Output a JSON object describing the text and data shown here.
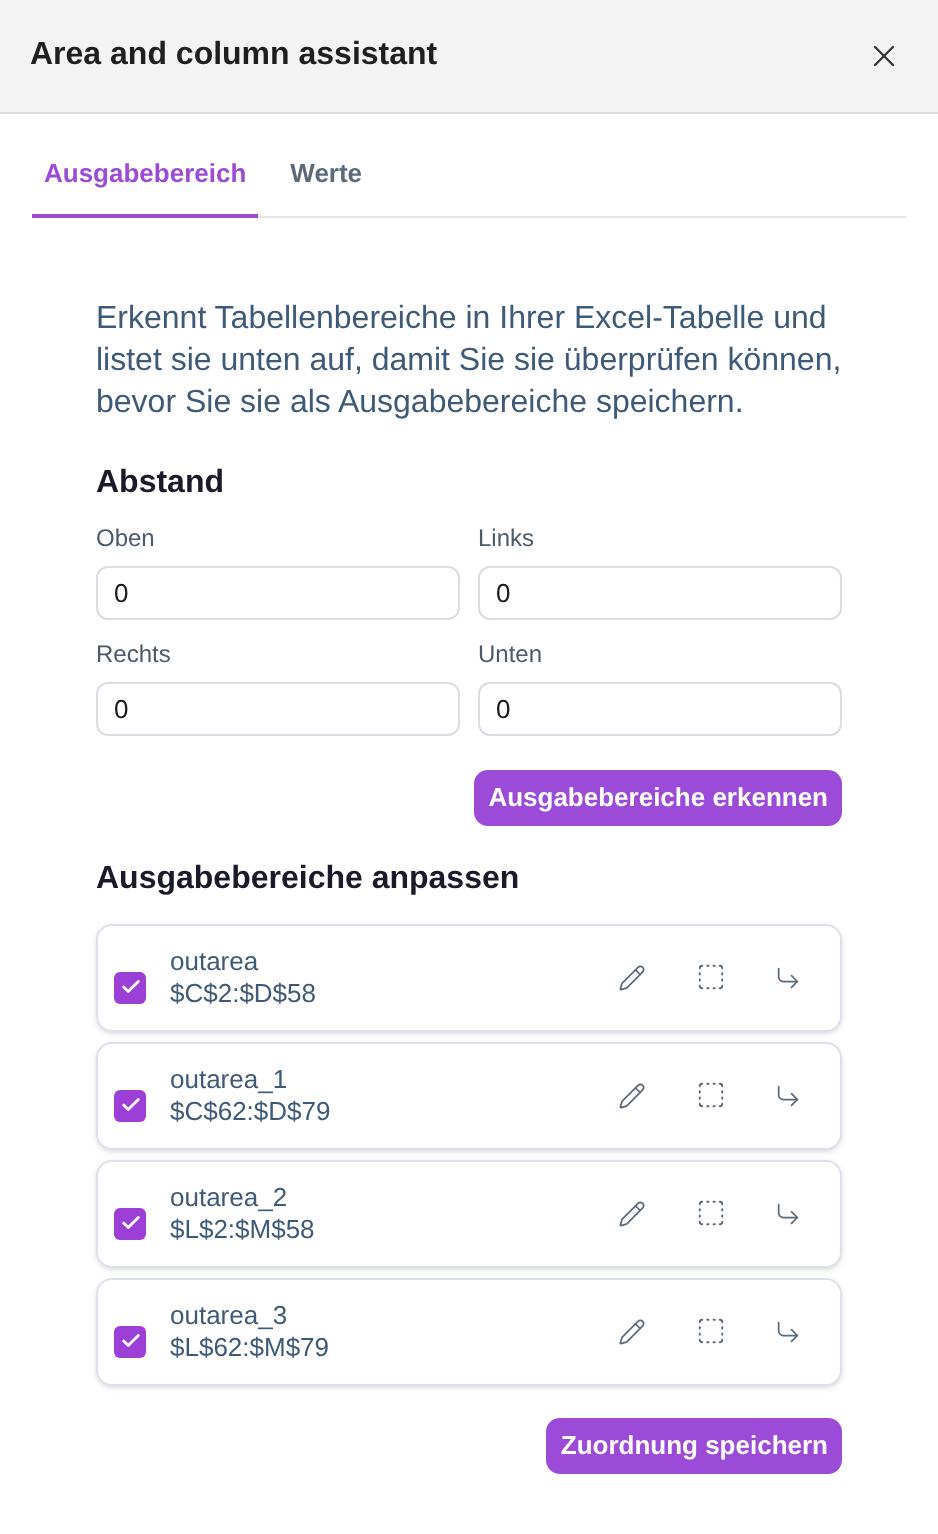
{
  "window": {
    "title": "Area and column assistant"
  },
  "tabs": [
    {
      "label": "Ausgabebereich",
      "selected": true
    },
    {
      "label": "Werte",
      "selected": false
    }
  ],
  "description": "Erkennt Tabellenbereiche in Ihrer Excel-Tabelle und listet sie unten auf, damit Sie sie überprüfen können, bevor Sie sie als Ausgabebereiche speichern.",
  "spacing": {
    "heading": "Abstand",
    "fields": [
      {
        "label": "Oben",
        "value": "0"
      },
      {
        "label": "Links",
        "value": "0"
      },
      {
        "label": "Rechts",
        "value": "0"
      },
      {
        "label": "Unten",
        "value": "0"
      }
    ]
  },
  "detect_button": "Ausgabebereiche erkennen",
  "areas": {
    "heading": "Ausgabebereiche anpassen",
    "items": [
      {
        "name": "outarea",
        "range": "$C$2:$D$58",
        "checked": true
      },
      {
        "name": "outarea_1",
        "range": "$C$62:$D$79",
        "checked": true
      },
      {
        "name": "outarea_2",
        "range": "$L$2:$M$58",
        "checked": true
      },
      {
        "name": "outarea_3",
        "range": "$L$62:$M$79",
        "checked": true
      }
    ]
  },
  "save_button": "Zuordnung speichern"
}
